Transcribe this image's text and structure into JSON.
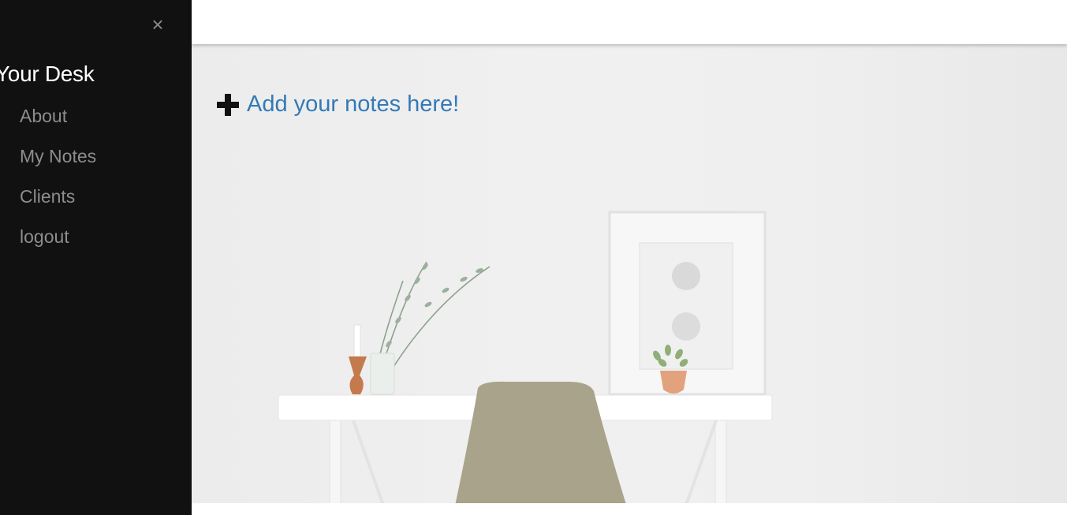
{
  "sidebar": {
    "close_icon": "close-icon",
    "close_glyph": "×",
    "brand": "Your Desk",
    "items": [
      {
        "label": "About"
      },
      {
        "label": "My Notes"
      },
      {
        "label": "Clients"
      },
      {
        "label": "logout"
      }
    ]
  },
  "main": {
    "add_note": {
      "icon": "plus-icon",
      "label": "Add your notes here!"
    }
  },
  "colors": {
    "sidebar_bg": "#111111",
    "sidebar_text": "#8d8d8d",
    "brand_text": "#ffffff",
    "link": "#337ab7"
  }
}
